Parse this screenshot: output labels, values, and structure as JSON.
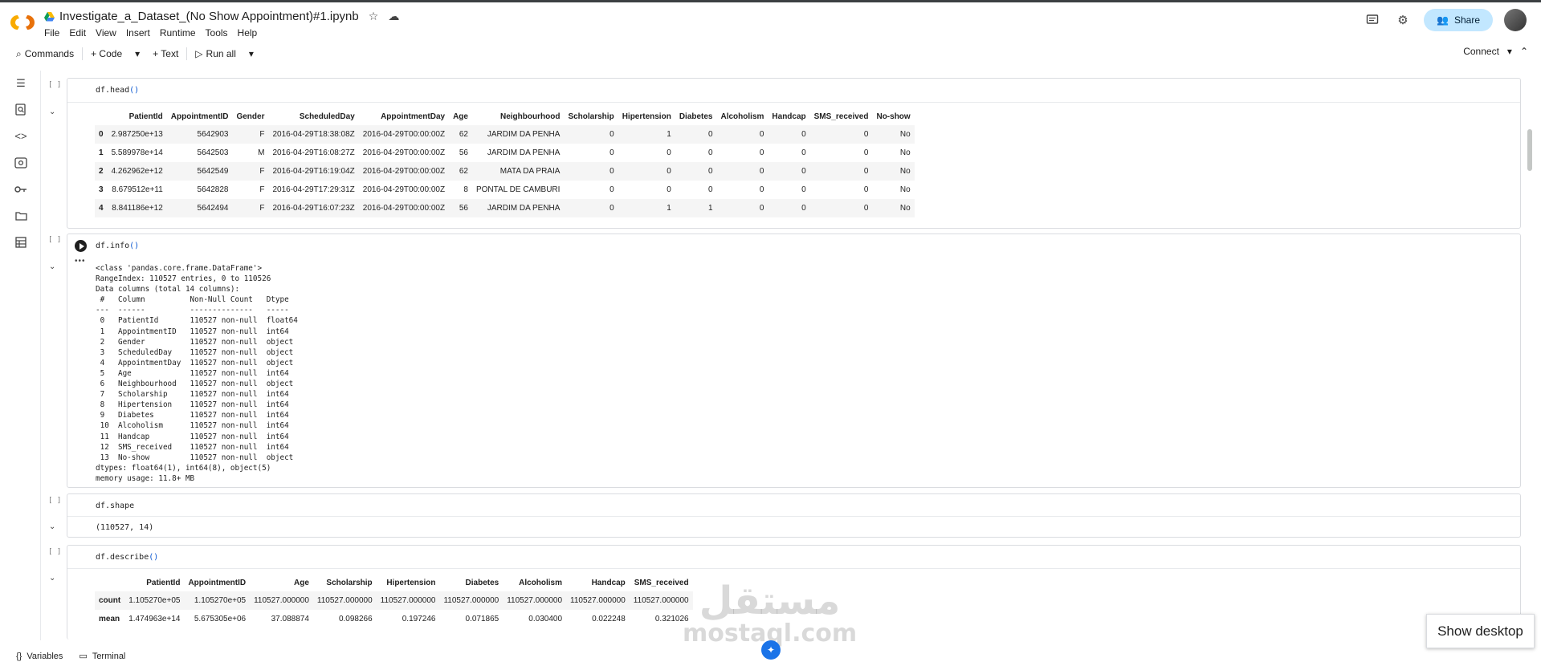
{
  "notebook": {
    "title": "Investigate_a_Dataset_(No Show Appointment)#1.ipynb",
    "menu": [
      "File",
      "Edit",
      "View",
      "Insert",
      "Runtime",
      "Tools",
      "Help"
    ],
    "share_label": "Share"
  },
  "toolbar": {
    "commands_label": "Commands",
    "code_label": "+ Code",
    "text_label": "+ Text",
    "run_all_label": "Run all",
    "connect_label": "Connect"
  },
  "cells": {
    "head": {
      "bracket": "[ ]",
      "code_name": "df.head",
      "code_paren": "()",
      "columns": [
        "",
        "PatientId",
        "AppointmentID",
        "Gender",
        "ScheduledDay",
        "AppointmentDay",
        "Age",
        "Neighbourhood",
        "Scholarship",
        "Hipertension",
        "Diabetes",
        "Alcoholism",
        "Handcap",
        "SMS_received",
        "No-show"
      ],
      "rows": [
        [
          "0",
          "2.987250e+13",
          "5642903",
          "F",
          "2016-04-29T18:38:08Z",
          "2016-04-29T00:00:00Z",
          "62",
          "JARDIM DA PENHA",
          "0",
          "1",
          "0",
          "0",
          "0",
          "0",
          "No"
        ],
        [
          "1",
          "5.589978e+14",
          "5642503",
          "M",
          "2016-04-29T16:08:27Z",
          "2016-04-29T00:00:00Z",
          "56",
          "JARDIM DA PENHA",
          "0",
          "0",
          "0",
          "0",
          "0",
          "0",
          "No"
        ],
        [
          "2",
          "4.262962e+12",
          "5642549",
          "F",
          "2016-04-29T16:19:04Z",
          "2016-04-29T00:00:00Z",
          "62",
          "MATA DA PRAIA",
          "0",
          "0",
          "0",
          "0",
          "0",
          "0",
          "No"
        ],
        [
          "3",
          "8.679512e+11",
          "5642828",
          "F",
          "2016-04-29T17:29:31Z",
          "2016-04-29T00:00:00Z",
          "8",
          "PONTAL DE CAMBURI",
          "0",
          "0",
          "0",
          "0",
          "0",
          "0",
          "No"
        ],
        [
          "4",
          "8.841186e+12",
          "5642494",
          "F",
          "2016-04-29T16:07:23Z",
          "2016-04-29T00:00:00Z",
          "56",
          "JARDIM DA PENHA",
          "0",
          "1",
          "1",
          "0",
          "0",
          "0",
          "No"
        ]
      ]
    },
    "info": {
      "bracket": "[ ]",
      "code_name": "df.info",
      "code_paren": "()",
      "output": "<class 'pandas.core.frame.DataFrame'>\nRangeIndex: 110527 entries, 0 to 110526\nData columns (total 14 columns):\n #   Column          Non-Null Count   Dtype  \n---  ------          --------------   -----  \n 0   PatientId       110527 non-null  float64\n 1   AppointmentID   110527 non-null  int64  \n 2   Gender          110527 non-null  object \n 3   ScheduledDay    110527 non-null  object \n 4   AppointmentDay  110527 non-null  object \n 5   Age             110527 non-null  int64  \n 6   Neighbourhood   110527 non-null  object \n 7   Scholarship     110527 non-null  int64  \n 8   Hipertension    110527 non-null  int64  \n 9   Diabetes        110527 non-null  int64  \n 10  Alcoholism      110527 non-null  int64  \n 11  Handcap         110527 non-null  int64  \n 12  SMS_received    110527 non-null  int64  \n 13  No-show         110527 non-null  object \ndtypes: float64(1), int64(8), object(5)\nmemory usage: 11.8+ MB"
    },
    "shape": {
      "bracket": "[ ]",
      "code": "df.shape",
      "output": "(110527, 14)"
    },
    "describe": {
      "bracket": "[ ]",
      "code_name": "df.describe",
      "code_paren": "()",
      "columns": [
        "",
        "PatientId",
        "AppointmentID",
        "Age",
        "Scholarship",
        "Hipertension",
        "Diabetes",
        "Alcoholism",
        "Handcap",
        "SMS_received"
      ],
      "rows": [
        [
          "count",
          "1.105270e+05",
          "1.105270e+05",
          "110527.000000",
          "110527.000000",
          "110527.000000",
          "110527.000000",
          "110527.000000",
          "110527.000000",
          "110527.000000"
        ],
        [
          "mean",
          "1.474963e+14",
          "5.675305e+06",
          "37.088874",
          "0.098266",
          "0.197246",
          "0.071865",
          "0.030400",
          "0.022248",
          "0.321026"
        ]
      ]
    }
  },
  "bottom": {
    "variables_label": "Variables",
    "terminal_label": "Terminal",
    "show_desktop_label": "Show desktop"
  },
  "watermark": {
    "arabic": "مستقل",
    "latin": "mostaql.com"
  },
  "colors": {
    "share_bg": "#c2e7ff",
    "accent": "#1a73e8",
    "paren": "#0b57d0",
    "logo_orange": "#f9ab00",
    "logo_dark": "#e8710a"
  },
  "icons": {
    "sidebar": [
      "toc-icon",
      "find-icon",
      "code-snippets-icon",
      "variables-inspector-icon",
      "secrets-key-icon",
      "files-folder-icon",
      "data-table-icon"
    ]
  }
}
